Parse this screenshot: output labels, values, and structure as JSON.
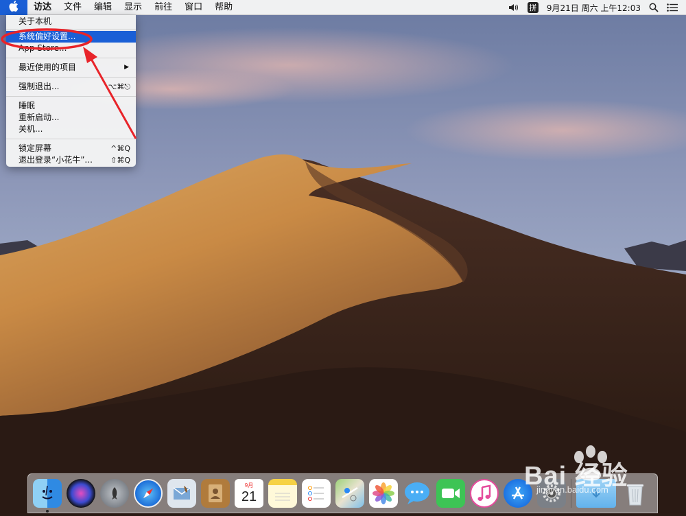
{
  "menubar": {
    "items": [
      "访达",
      "文件",
      "编辑",
      "显示",
      "前往",
      "窗口",
      "帮助"
    ],
    "ime_label": "拼",
    "datetime": "9月21日 周六 上午12:03"
  },
  "apple_menu": {
    "about": "关于本机",
    "system_prefs": "系统偏好设置...",
    "app_store": "App Store...",
    "recent": "最近使用的项目",
    "force_quit": "强制退出...",
    "force_quit_shortcut": "⌥⌘⎋",
    "sleep": "睡眠",
    "restart": "重新启动...",
    "shutdown": "关机...",
    "lock": "锁定屏幕",
    "lock_shortcut": "^⌘Q",
    "logout": "退出登录“小花牛”...",
    "logout_shortcut": "⇧⌘Q"
  },
  "dock": {
    "calendar_month": "9月",
    "calendar_day": "21"
  },
  "watermark": {
    "text": "Bai 经验",
    "sub": "jingyan.baidu.com"
  },
  "colors": {
    "highlight": "#1a5fd6",
    "annotation": "#e8242a"
  },
  "icons": [
    "apple-icon",
    "volume-icon",
    "search-icon",
    "list-icon",
    "finder-icon",
    "siri-icon",
    "launchpad-icon",
    "safari-icon",
    "mail-icon",
    "contacts-icon",
    "calendar-icon",
    "notes-icon",
    "reminders-icon",
    "maps-icon",
    "photos-icon",
    "messages-icon",
    "facetime-icon",
    "itunes-icon",
    "appstore-icon",
    "system-preferences-icon",
    "downloads-folder-icon",
    "trash-icon"
  ]
}
